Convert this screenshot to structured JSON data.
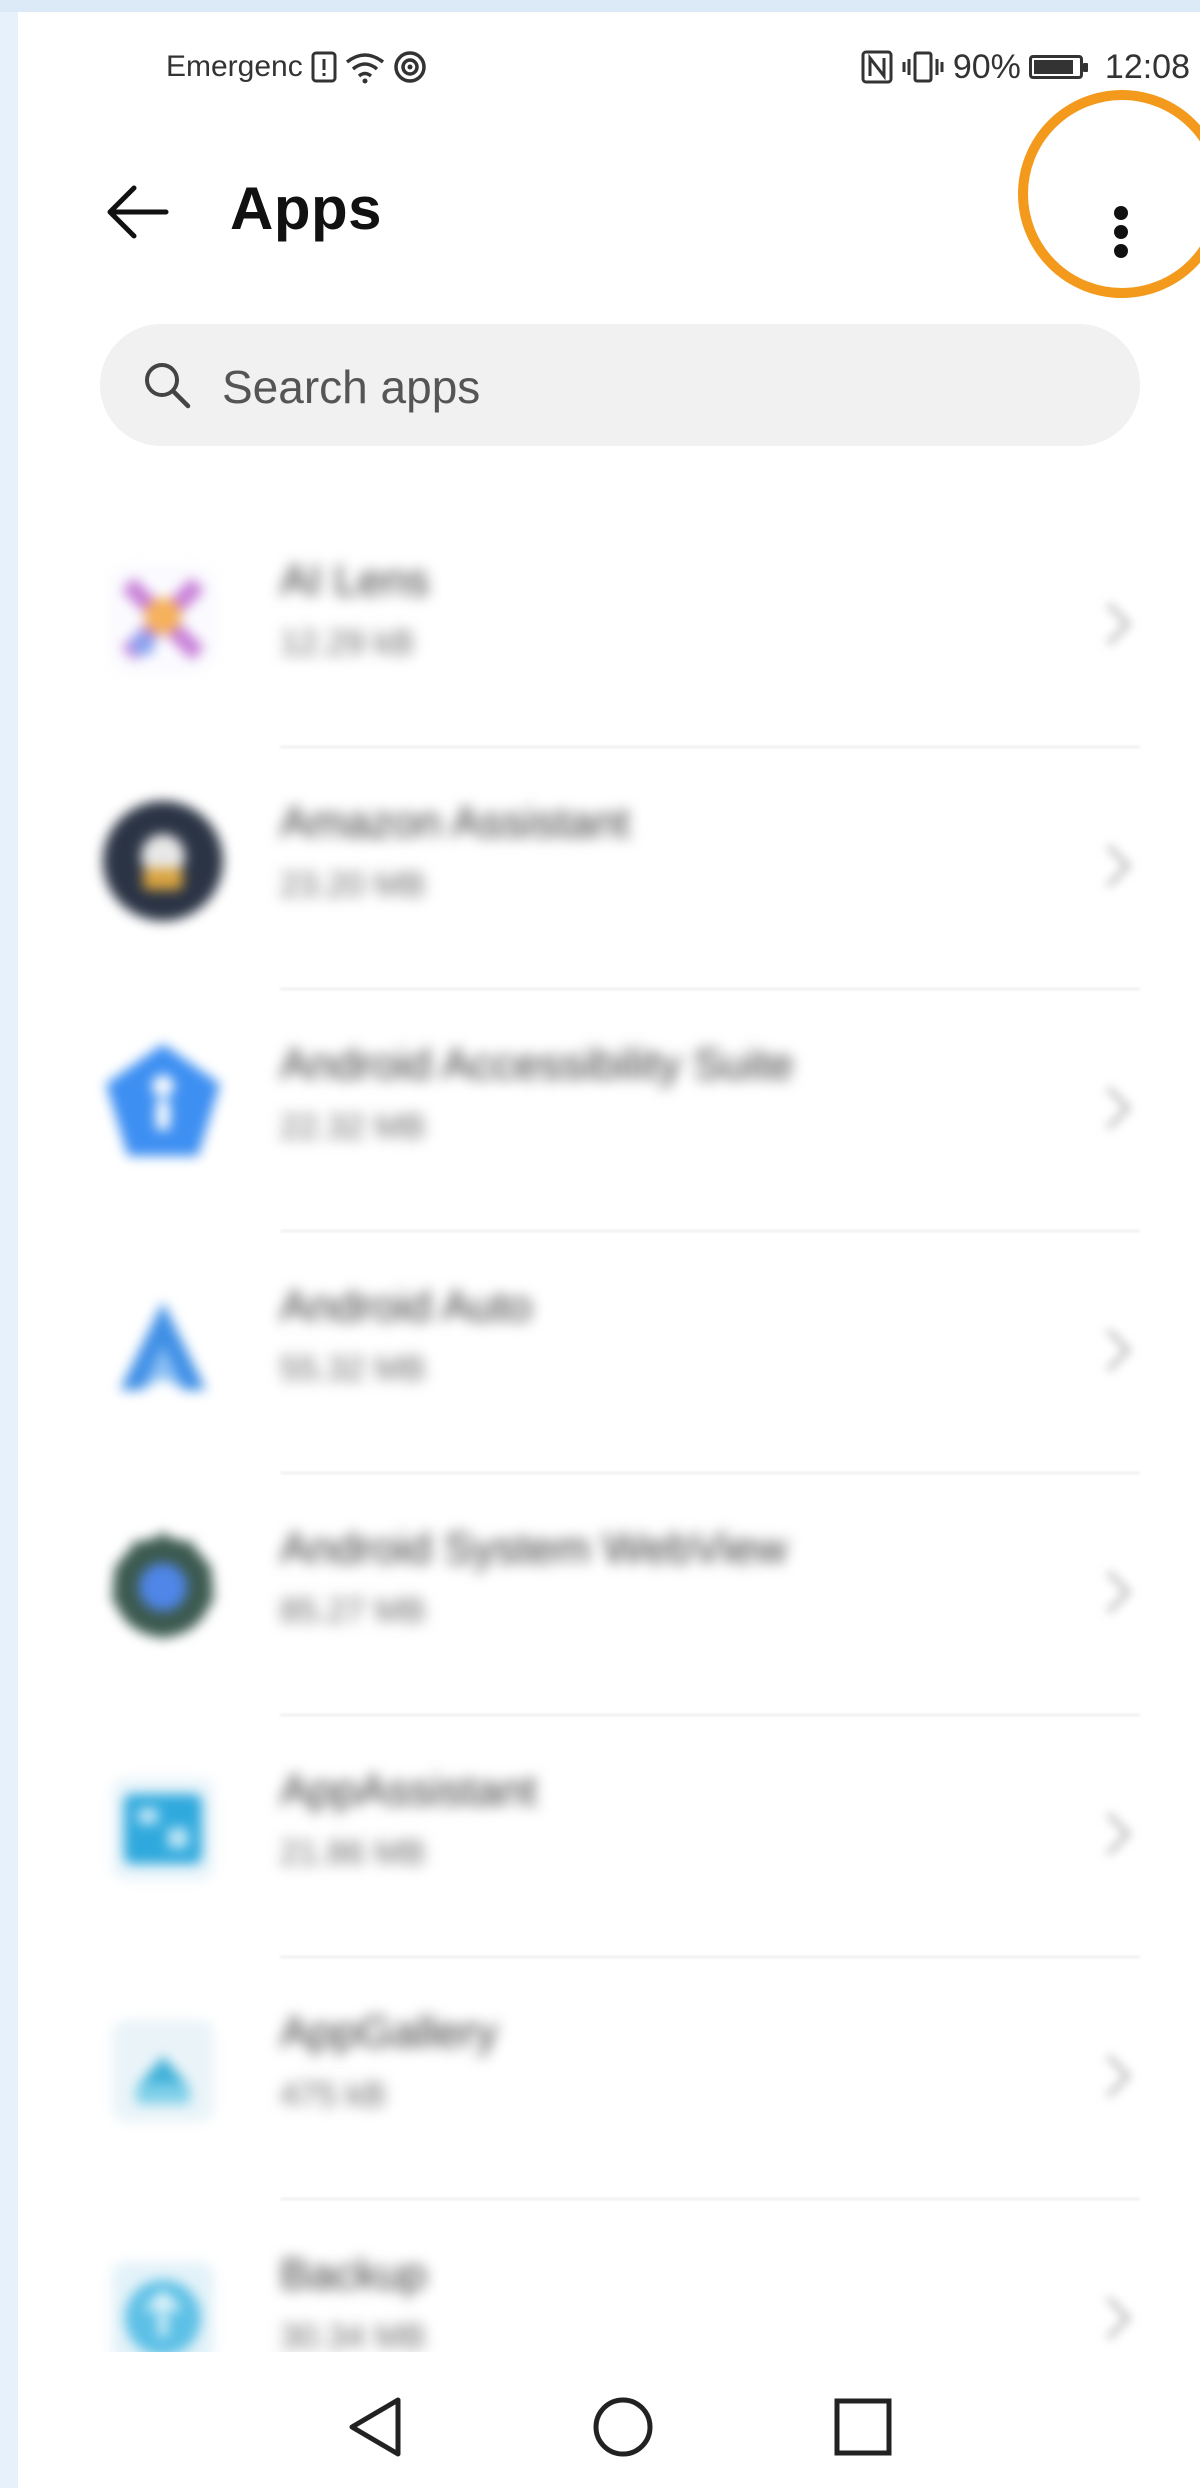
{
  "status_bar": {
    "carrier": "Emergenc",
    "battery_percent": "90%",
    "battery_level": 0.9,
    "time": "12:08",
    "icons": [
      "sim-alert-icon",
      "wifi-icon",
      "hotspot-icon",
      "nfc-icon",
      "vibrate-icon",
      "battery-icon"
    ]
  },
  "header": {
    "title": "Apps",
    "back_icon": "arrow-left-icon",
    "menu_icon": "more-vertical-icon"
  },
  "highlight_color": "#f39a1d",
  "search": {
    "placeholder": "Search apps",
    "icon": "search-icon"
  },
  "apps": [
    {
      "name": "AI Lens",
      "size": "12.29 kB",
      "icon": "ai-lens-icon"
    },
    {
      "name": "Amazon Assistant",
      "size": "23.20 MB",
      "icon": "amazon-assistant-icon"
    },
    {
      "name": "Android Accessibility Suite",
      "size": "22.32 MB",
      "icon": "accessibility-suite-icon"
    },
    {
      "name": "Android Auto",
      "size": "55.32 MB",
      "icon": "android-auto-icon"
    },
    {
      "name": "Android System WebView",
      "size": "85.27 MB",
      "icon": "webview-icon"
    },
    {
      "name": "AppAssistant",
      "size": "21.86 MB",
      "icon": "app-assistant-icon"
    },
    {
      "name": "AppGallery",
      "size": "475 kB",
      "icon": "appgallery-icon"
    },
    {
      "name": "Backup",
      "size": "30.34 MB",
      "icon": "backup-icon"
    }
  ],
  "nav_bar": {
    "buttons": [
      "back-triangle-icon",
      "home-circle-icon",
      "recents-square-icon"
    ]
  }
}
